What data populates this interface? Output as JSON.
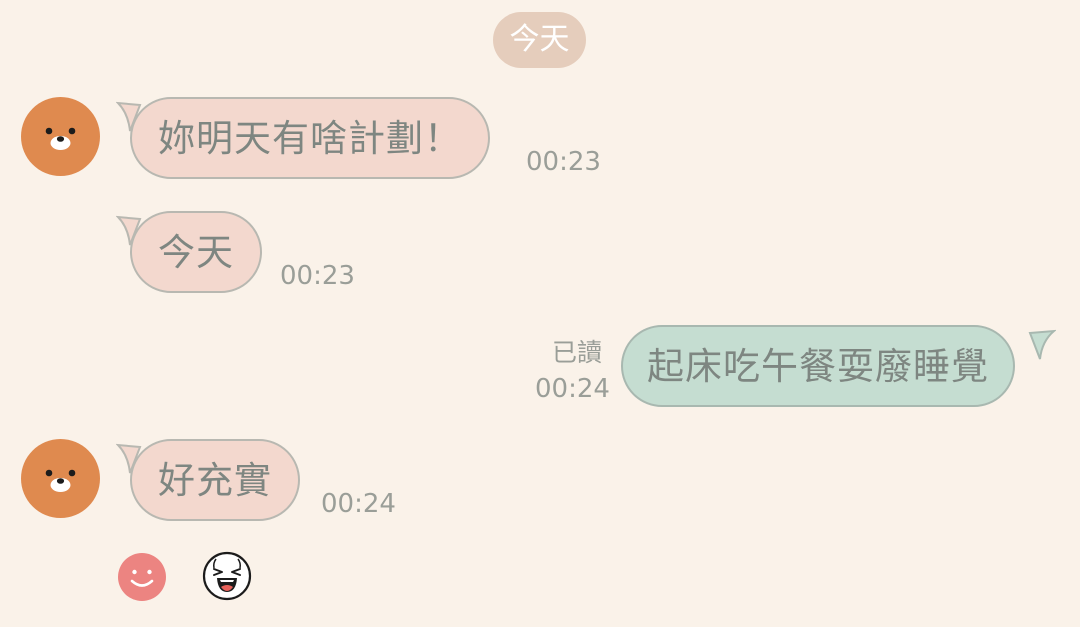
{
  "date_divider": "今天",
  "messages": [
    {
      "sender": "friend",
      "text": "妳明天有啥計劃！",
      "time": "00:23"
    },
    {
      "sender": "friend",
      "text": "今天",
      "time": "00:23"
    },
    {
      "sender": "me",
      "text": "起床吃午餐耍廢睡覺",
      "time": "00:24",
      "read_label": "已讀"
    },
    {
      "sender": "friend",
      "text": "好充實",
      "time": "00:24"
    }
  ],
  "reactions": [
    {
      "icon": "smiley-face-icon",
      "color": "#ec8481"
    },
    {
      "icon": "laughing-face-icon",
      "color": "#ffffff"
    }
  ],
  "colors": {
    "background": "#faf2e9",
    "incoming_bubble": "#f3d8ce",
    "outgoing_bubble": "#c5ddd1",
    "avatar": "#df8a4f",
    "date_pill": "#e5cdbc"
  },
  "avatar_icon": "bear-avatar-icon"
}
